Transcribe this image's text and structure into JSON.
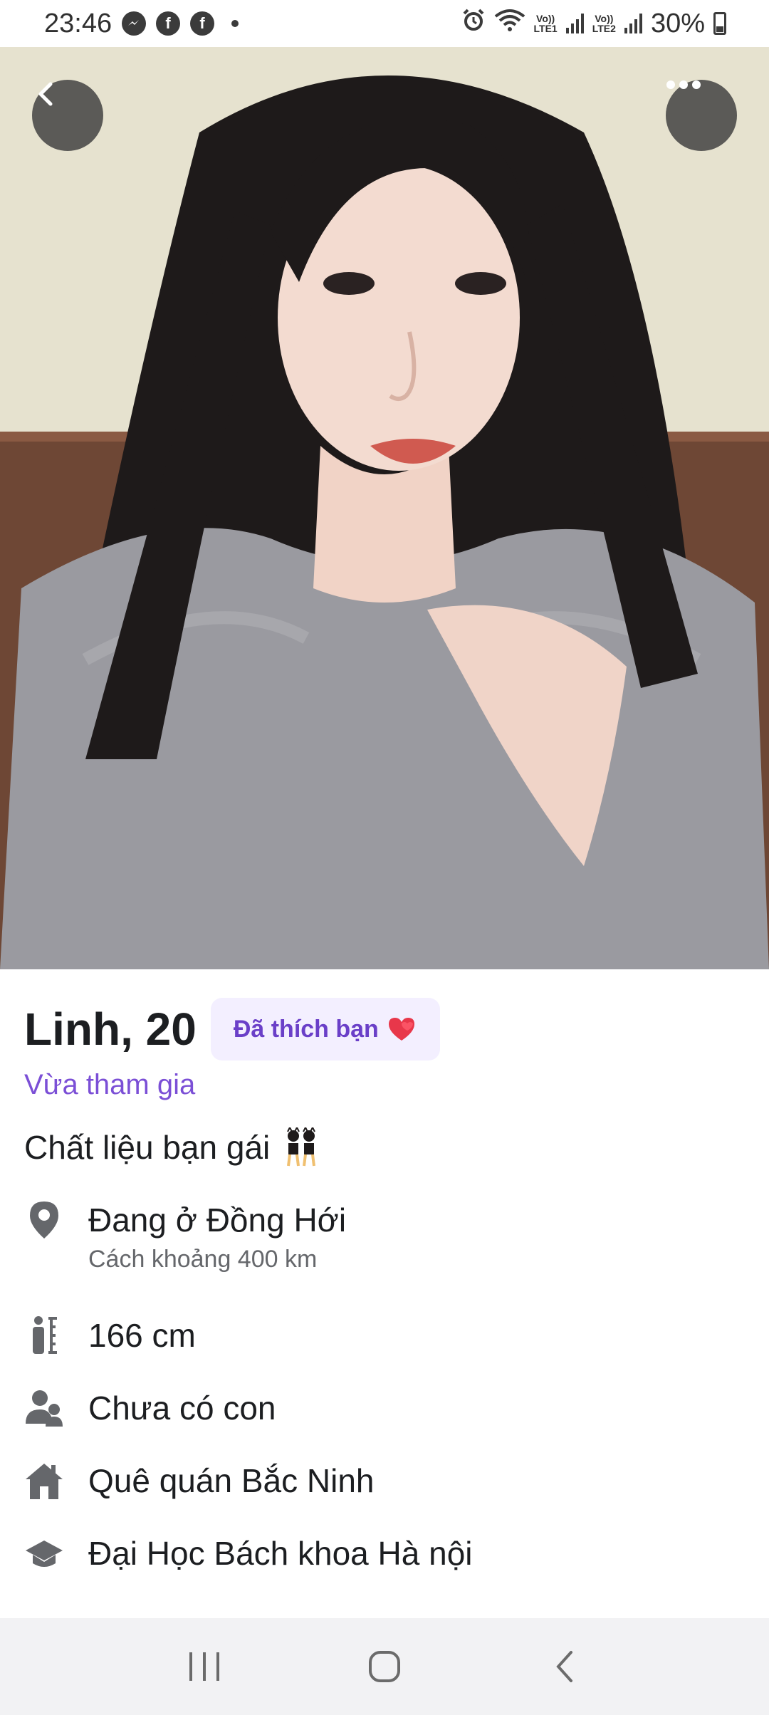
{
  "status_bar": {
    "time": "23:46",
    "notification_icons": [
      "messenger-icon",
      "facebook-icon",
      "facebook-icon"
    ],
    "sim1_label": "LTE1",
    "sim2_label": "LTE2",
    "volte_label": "Vo))",
    "battery_percent": "30%"
  },
  "photo": {
    "description_icon": "profile-photo"
  },
  "profile": {
    "name_age": "Linh, 20",
    "liked_badge": "Đã thích bạn",
    "joined_label": "Vừa tham gia",
    "bio": "Chất liệu bạn gái",
    "location_main": "Đang ở Đồng Hới",
    "location_sub": "Cách  khoảng 400 km",
    "height": "166 cm",
    "children": "Chưa có con",
    "hometown": "Quê quán Bắc Ninh",
    "education": "Đại Học Bách khoa Hà nội"
  },
  "colors": {
    "accent": "#7b4fd6",
    "badge_bg": "#f3efff",
    "badge_text": "#6a3fc8",
    "icon_gray": "#65676b"
  }
}
